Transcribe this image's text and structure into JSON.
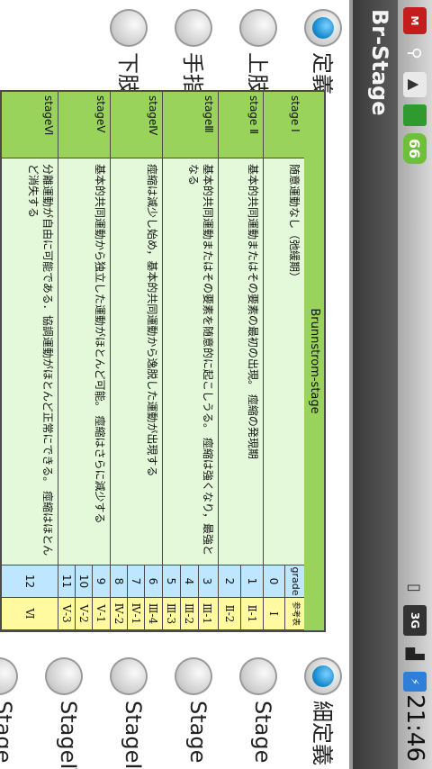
{
  "status": {
    "time": "21:46",
    "network": "3G",
    "badge": "66"
  },
  "app": {
    "title": "Br-Stage"
  },
  "left_options": [
    {
      "label": "定義",
      "checked": true
    },
    {
      "label": "上肢",
      "checked": false
    },
    {
      "label": "手指",
      "checked": false
    },
    {
      "label": "下肢",
      "checked": false
    }
  ],
  "right_options": [
    {
      "label": "細定義",
      "checked": true
    },
    {
      "label": "Stage Ⅰ",
      "checked": false
    },
    {
      "label": "Stage Ⅱ",
      "checked": false
    },
    {
      "label": "StageⅢ",
      "checked": false
    },
    {
      "label": "StageⅣ",
      "checked": false
    },
    {
      "label": "Stage Ⅴ",
      "checked": false
    }
  ],
  "table": {
    "title": "Brunnstrom-stage",
    "headers": {
      "grade": "grade",
      "ref": "参考表記"
    },
    "stages": [
      {
        "name": "stage Ⅰ",
        "desc": "随意運動なし（弛緩期）"
      },
      {
        "name": "stage Ⅱ",
        "desc": "基本的共同運動またはその要素の最初の出現。 痙縮の発現期"
      },
      {
        "name": "stageⅢ",
        "desc": "基本的共同運動またはその要素を随意的に起こしうる。 痙縮は強くなり，最強となる"
      },
      {
        "name": "stageⅣ",
        "desc": "痙縮は減少し始め，基本的共同運動から逸脱した運動が出現する"
      },
      {
        "name": "stageⅤ",
        "desc": "基本的共同運動から独立した運動がほとんど可能。 痙縮はさらに減少する"
      },
      {
        "name": "stageⅥ",
        "desc": "分離運動が自由に可能である．協調運動がほとんど正常にできる。 痙縮はほとんど消失する"
      }
    ],
    "grades": [
      "0",
      "1",
      "2",
      "3",
      "4",
      "5",
      "6",
      "7",
      "8",
      "9",
      "10",
      "11",
      "12"
    ],
    "refs": [
      "Ⅰ",
      "Ⅱ-1",
      "Ⅱ-2",
      "Ⅲ-1",
      "Ⅲ-2",
      "Ⅲ-3",
      "Ⅲ-4",
      "Ⅳ-1",
      "Ⅳ-2",
      "Ⅴ-1",
      "Ⅴ-2",
      "Ⅴ-3",
      "Ⅵ"
    ]
  }
}
